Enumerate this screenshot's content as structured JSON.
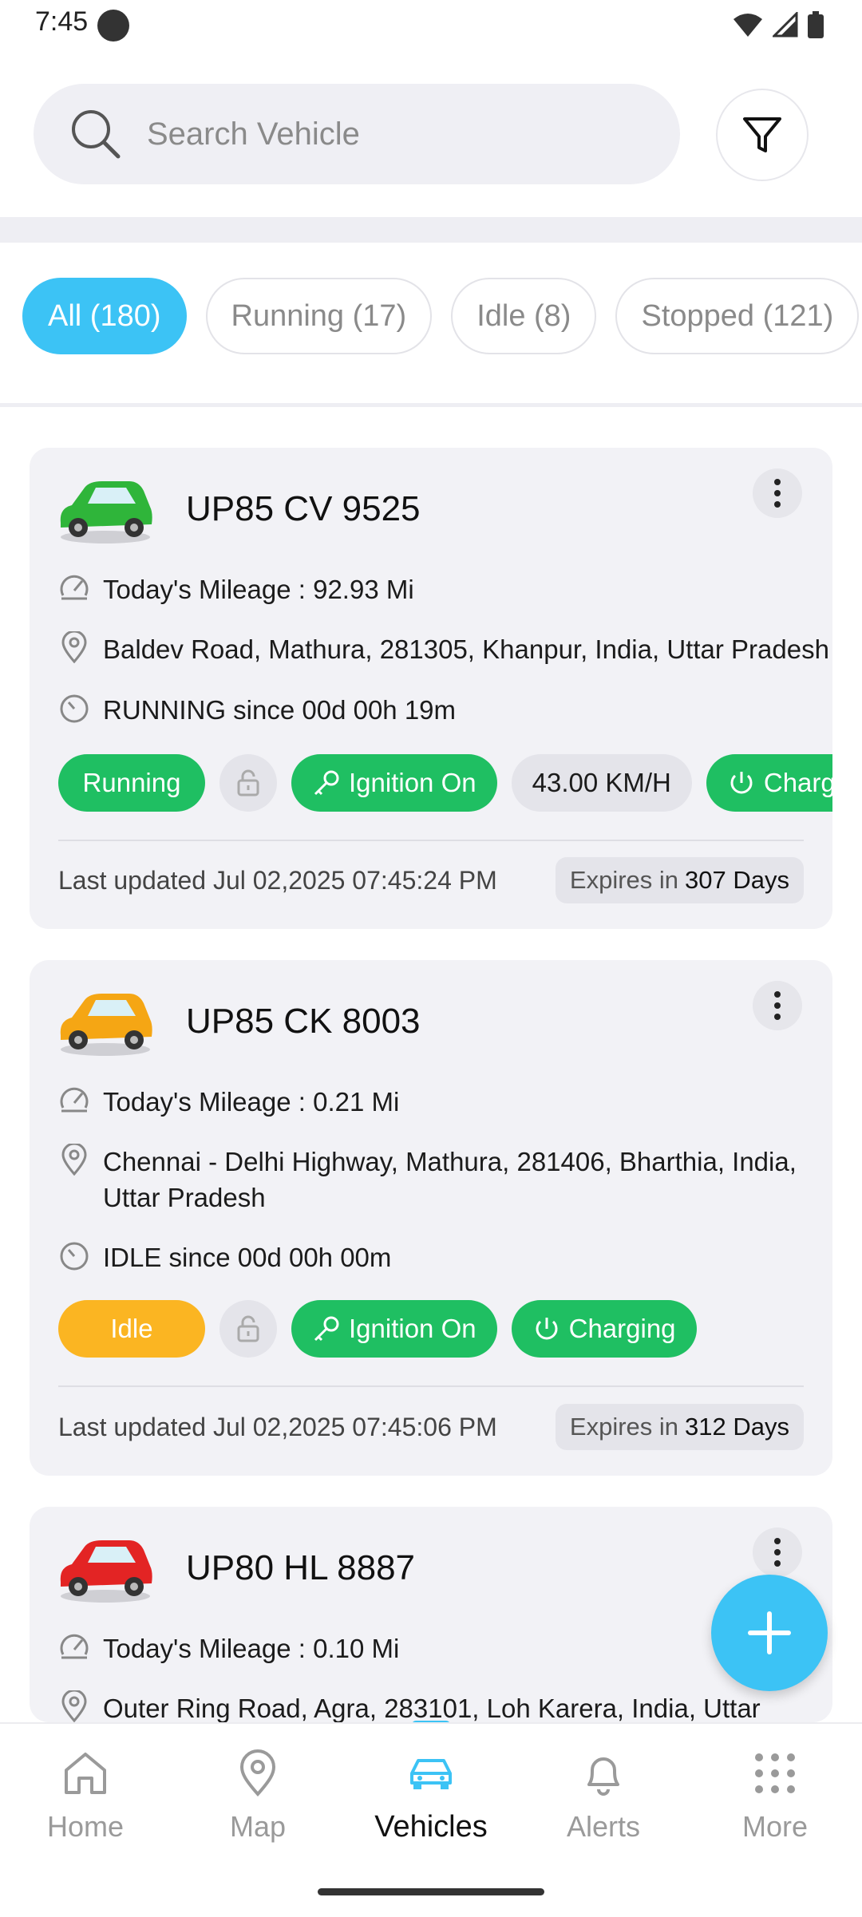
{
  "status_bar": {
    "time": "7:45"
  },
  "search": {
    "placeholder": "Search Vehicle"
  },
  "filters": [
    {
      "label": "All (180)",
      "active": true
    },
    {
      "label": "Running (17)",
      "active": false
    },
    {
      "label": "Idle (8)",
      "active": false
    },
    {
      "label": "Stopped (121)",
      "active": false
    }
  ],
  "vehicles": [
    {
      "plate": "UP85 CV 9525",
      "car_color": "#2fb53a",
      "mileage": "Today's Mileage : 92.93 Mi",
      "address": "Baldev Road, Mathura, 281305, Khanpur, India, Uttar Pradesh",
      "state_since": "RUNNING since  00d 00h 19m",
      "status_badge": "Running",
      "ignition": "Ignition On",
      "speed": "43.00 KM/H",
      "charging": "Charging",
      "last_updated": "Last updated  Jul 02,2025 07:45:24 PM",
      "expires_label": "Expires in",
      "expires_value": "307 Days"
    },
    {
      "plate": "UP85 CK 8003",
      "car_color": "#f5a614",
      "mileage": "Today's Mileage : 0.21 Mi",
      "address": "Chennai - Delhi Highway, Mathura, 281406, Bharthia, India, Uttar Pradesh",
      "state_since": "IDLE since  00d 00h 00m",
      "status_badge": "Idle",
      "ignition": "Ignition On",
      "charging": "Charging",
      "last_updated": "Last updated  Jul 02,2025 07:45:06 PM",
      "expires_label": "Expires in",
      "expires_value": "312 Days"
    },
    {
      "plate": "UP80 HL 8887",
      "car_color": "#e32424",
      "mileage": "Today's Mileage : 0.10 Mi",
      "address": "Outer Ring Road, Agra, 283101, Loh Karera, India, Uttar"
    }
  ],
  "nav": [
    {
      "label": "Home",
      "icon": "home-icon",
      "active": false
    },
    {
      "label": "Map",
      "icon": "map-pin-icon",
      "active": false
    },
    {
      "label": "Vehicles",
      "icon": "car-icon",
      "active": true
    },
    {
      "label": "Alerts",
      "icon": "bell-icon",
      "active": false
    },
    {
      "label": "More",
      "icon": "grid-icon",
      "active": false
    }
  ],
  "colors": {
    "accent": "#3cc3f5",
    "running": "#1fbf62",
    "idle": "#fbb522"
  }
}
